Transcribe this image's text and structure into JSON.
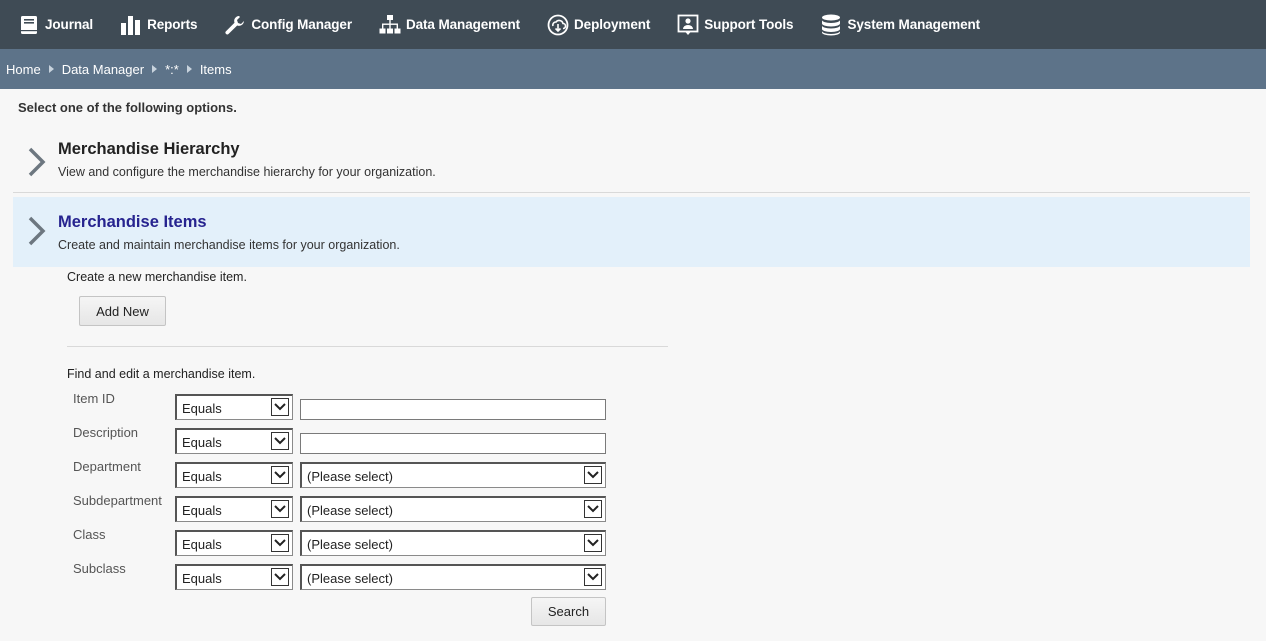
{
  "nav": {
    "items": [
      {
        "label": "Journal",
        "icon": "journal-icon"
      },
      {
        "label": "Reports",
        "icon": "bar-chart-icon"
      },
      {
        "label": "Config Manager",
        "icon": "wrench-icon"
      },
      {
        "label": "Data Management",
        "icon": "hierarchy-icon"
      },
      {
        "label": "Deployment",
        "icon": "cloud-download-icon"
      },
      {
        "label": "Support Tools",
        "icon": "support-person-icon"
      },
      {
        "label": "System Management",
        "icon": "database-icon"
      }
    ]
  },
  "breadcrumb": {
    "items": [
      "Home",
      "Data Manager",
      "*:*",
      "Items"
    ]
  },
  "page": {
    "instruction": "Select one of the following options.",
    "options": [
      {
        "title": "Merchandise Hierarchy",
        "description": "View and configure the merchandise hierarchy for your organization."
      },
      {
        "title": "Merchandise Items",
        "description": "Create and maintain merchandise items for your organization."
      }
    ],
    "create_label": "Create a new merchandise item.",
    "add_new_label": "Add New",
    "find_label": "Find and edit a merchandise item.",
    "search_label": "Search"
  },
  "form": {
    "fields": [
      {
        "label": "Item ID",
        "operator": "Equals",
        "value": ""
      },
      {
        "label": "Description",
        "operator": "Equals",
        "value": ""
      },
      {
        "label": "Department",
        "operator": "Equals",
        "value": "(Please select)"
      },
      {
        "label": "Subdepartment",
        "operator": "Equals",
        "value": "(Please select)"
      },
      {
        "label": "Class",
        "operator": "Equals",
        "value": "(Please select)"
      },
      {
        "label": "Subclass",
        "operator": "Equals",
        "value": "(Please select)"
      }
    ]
  },
  "colors": {
    "topnav_bg": "#3f4b55",
    "breadcrumb_bg": "#5d7389",
    "selected_option_bg": "#e3f0fa",
    "selected_option_title": "#26238f"
  }
}
